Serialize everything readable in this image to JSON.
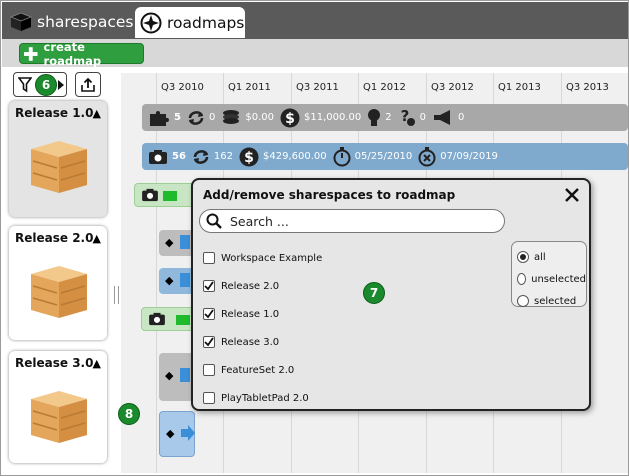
{
  "header": {
    "app_name": "sharespaces",
    "active_tab": "roadmaps"
  },
  "toolbar": {
    "create_label": "create roadmap",
    "filter_badge": "6"
  },
  "timeline": {
    "columns": [
      "Q3 2010",
      "Q1 2011",
      "Q3 2011",
      "Q1 2012",
      "Q3 2012",
      "Q1 2013",
      "Q3 2013"
    ]
  },
  "releases": [
    {
      "title": "Release 1.0"
    },
    {
      "title": "Release 2.0"
    },
    {
      "title": "Release 3.0"
    }
  ],
  "summary_gray": {
    "features": "5",
    "cycles": "0",
    "cost1": "$0.00",
    "cost2": "$11,000.00",
    "ideas": "2",
    "questions": "0",
    "announcements": "0"
  },
  "summary_blue": {
    "items": "56",
    "cycles": "162",
    "budget": "$429,600.00",
    "start": "05/25/2010",
    "end": "07/09/2019"
  },
  "modal": {
    "title": "Add/remove sharespaces to roadmap",
    "search_placeholder": "Search ...",
    "items": [
      {
        "label": "Workspace Example",
        "checked": false
      },
      {
        "label": "Release 2.0",
        "checked": true
      },
      {
        "label": "Release 1.0",
        "checked": true
      },
      {
        "label": "Release 3.0",
        "checked": true
      },
      {
        "label": "FeatureSet 2.0",
        "checked": false
      },
      {
        "label": "PlayTabletPad 2.0",
        "checked": false
      }
    ],
    "filters": [
      {
        "label": "all",
        "selected": true
      },
      {
        "label": "unselected",
        "selected": false
      },
      {
        "label": "selected",
        "selected": false
      }
    ]
  },
  "callouts": {
    "modal_badge": "7",
    "sidebar_badge": "8"
  },
  "colors": {
    "topbar": "#5a5a5a",
    "create_button": "#2f9e3f",
    "badge": "#1a8a2c",
    "summary_gray": "#a8a8a8",
    "summary_blue": "#7fa9cd"
  }
}
